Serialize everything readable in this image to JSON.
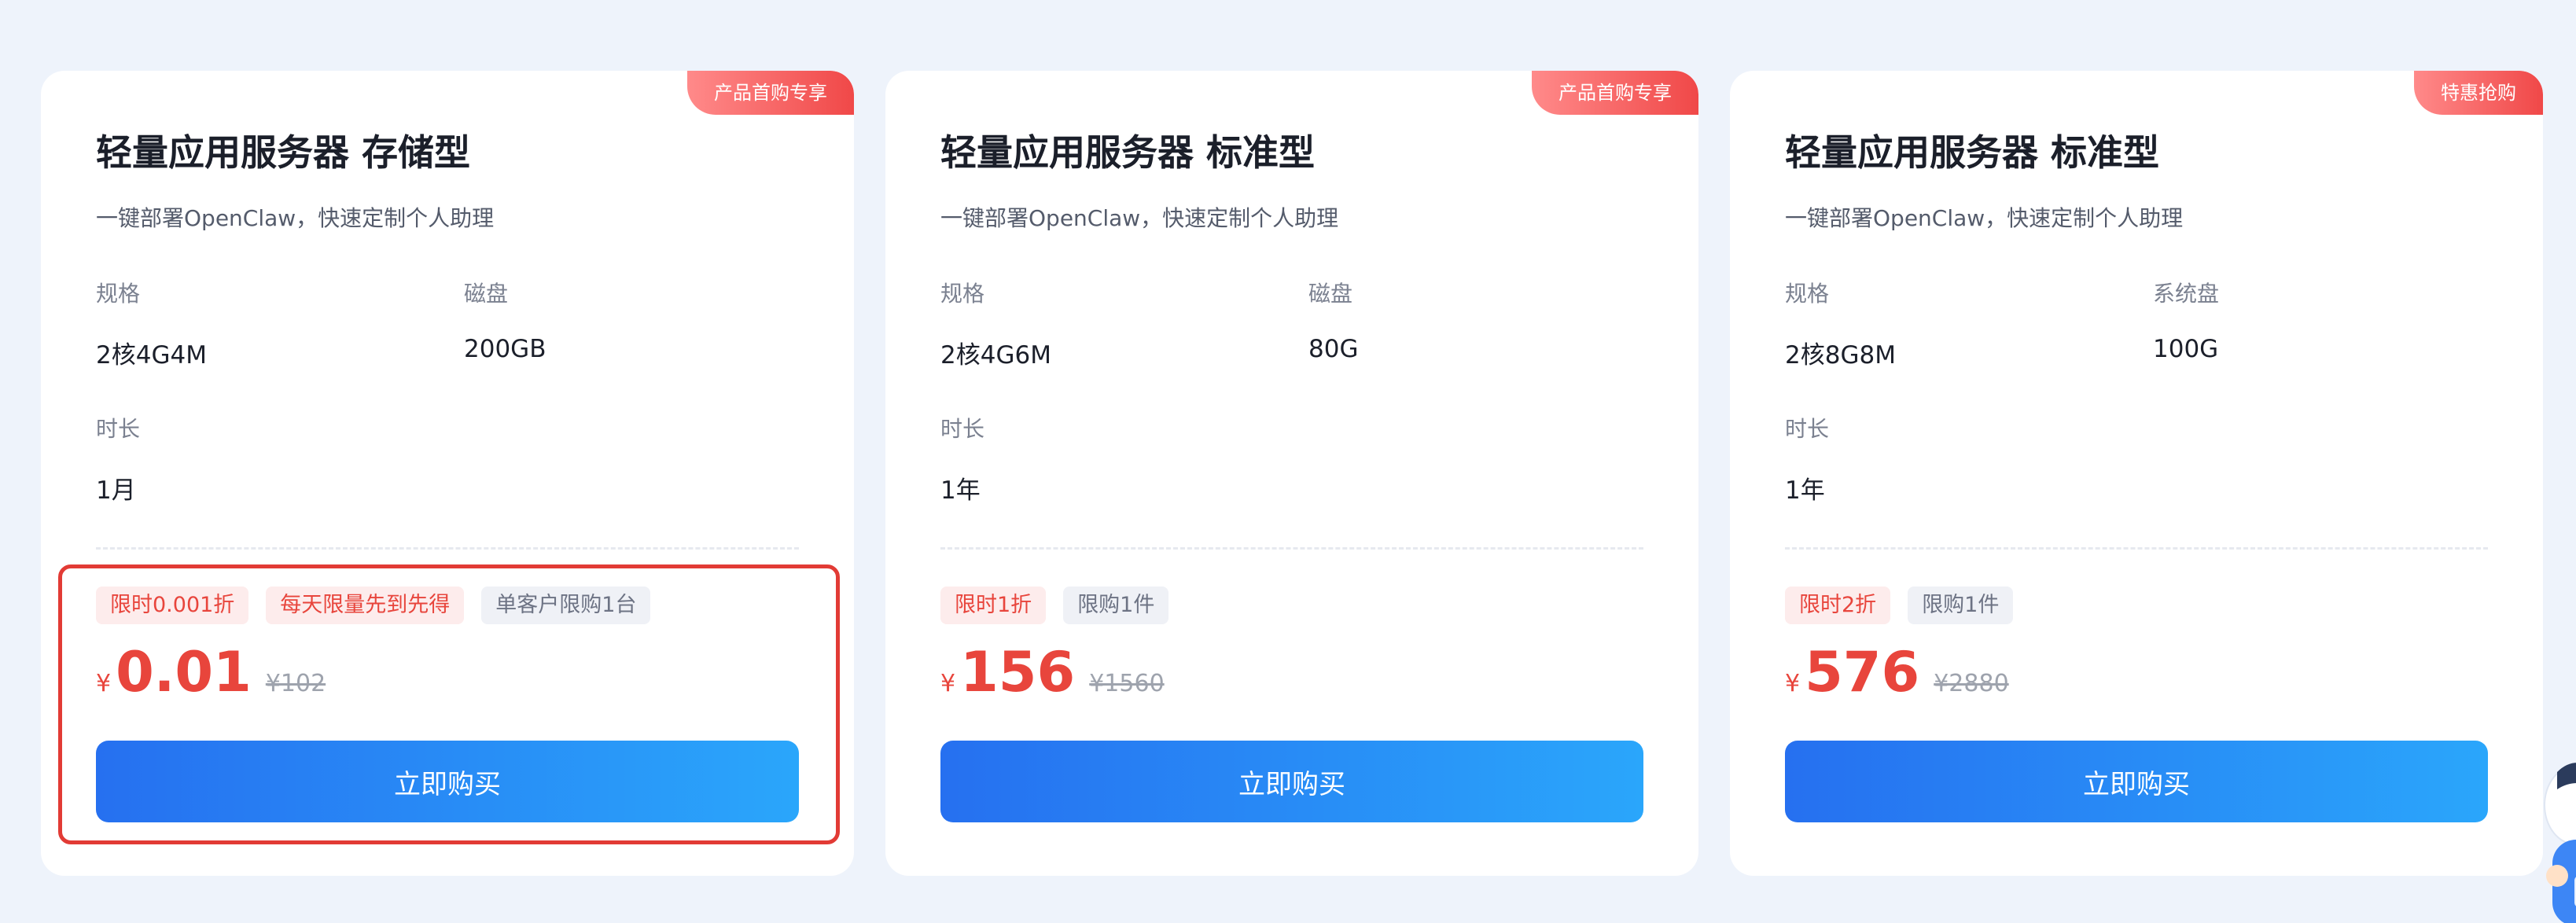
{
  "cards": [
    {
      "corner_tag": "产品首购专享",
      "title": "轻量应用服务器 存储型",
      "subtitle": "一键部署OpenClaw，快速定制个人助理",
      "specs": {
        "spec_label": "规格",
        "spec_value": "2核4G4M",
        "disk_label": "磁盘",
        "disk_value": "200GB",
        "duration_label": "时长",
        "duration_value": "1月"
      },
      "tags": [
        {
          "text": "限时0.001折",
          "style": "red"
        },
        {
          "text": "每天限量先到先得",
          "style": "red"
        },
        {
          "text": "单客户限购1台",
          "style": "gray"
        }
      ],
      "currency": "¥",
      "price": "0.01",
      "original_price": "¥102",
      "button_label": "立即购买"
    },
    {
      "corner_tag": "产品首购专享",
      "title": "轻量应用服务器 标准型",
      "subtitle": "一键部署OpenClaw，快速定制个人助理",
      "specs": {
        "spec_label": "规格",
        "spec_value": "2核4G6M",
        "disk_label": "磁盘",
        "disk_value": "80G",
        "duration_label": "时长",
        "duration_value": "1年"
      },
      "tags": [
        {
          "text": "限时1折",
          "style": "red"
        },
        {
          "text": "限购1件",
          "style": "gray"
        }
      ],
      "currency": "¥",
      "price": "156",
      "original_price": "¥1560",
      "button_label": "立即购买"
    },
    {
      "corner_tag": "特惠抢购",
      "title": "轻量应用服务器 标准型",
      "subtitle": "一键部署OpenClaw，快速定制个人助理",
      "specs": {
        "spec_label": "规格",
        "spec_value": "2核8G8M",
        "disk_label": "系统盘",
        "disk_value": "100G",
        "duration_label": "时长",
        "duration_value": "1年"
      },
      "tags": [
        {
          "text": "限时2折",
          "style": "red"
        },
        {
          "text": "限购1件",
          "style": "gray"
        }
      ],
      "currency": "¥",
      "price": "576",
      "original_price": "¥2880",
      "button_label": "立即购买"
    }
  ],
  "colors": {
    "background": "#eef3fb",
    "price_red": "#e8453c",
    "button_gradient_start": "#2670f0",
    "button_gradient_end": "#2aa6fb",
    "highlight_border": "#e23b35"
  }
}
